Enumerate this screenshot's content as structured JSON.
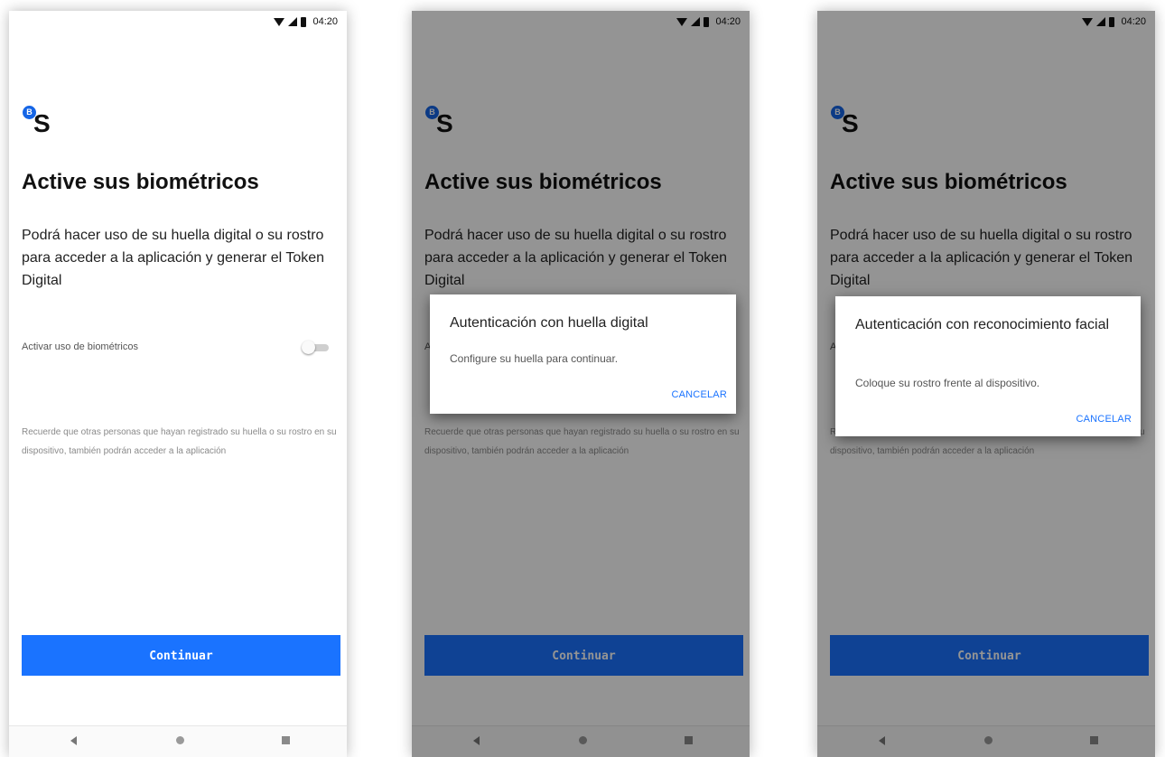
{
  "status_bar": {
    "time": "04:20"
  },
  "logo": {
    "badge_letter": "B",
    "letter": "S",
    "brand_color": "#1565e6"
  },
  "screen": {
    "title": "Active sus biométricos",
    "description": "Podrá hacer uso de su huella digital o su rostro para acceder a la aplicación y generar el Token Digital",
    "toggle_label": "Activar uso de biométricos",
    "toggle_on": false,
    "note": "Recuerde que otras personas que hayan registrado su huella o su rostro en su dispositivo, también podrán acceder a la aplicación",
    "continue_label": "Continuar",
    "accent_color": "#1a73ff"
  },
  "nav_bar": {
    "icons": [
      "back-icon",
      "home-icon",
      "recents-icon"
    ]
  },
  "dialogs": {
    "fingerprint": {
      "title": "Autenticación con huella digital",
      "body": "Configure su huella para continuar.",
      "cancel_label": "CANCELAR"
    },
    "face": {
      "title": "Autenticación con reconocimiento facial",
      "body": "Coloque su rostro frente al dispositivo.",
      "cancel_label": "CANCELAR"
    }
  }
}
